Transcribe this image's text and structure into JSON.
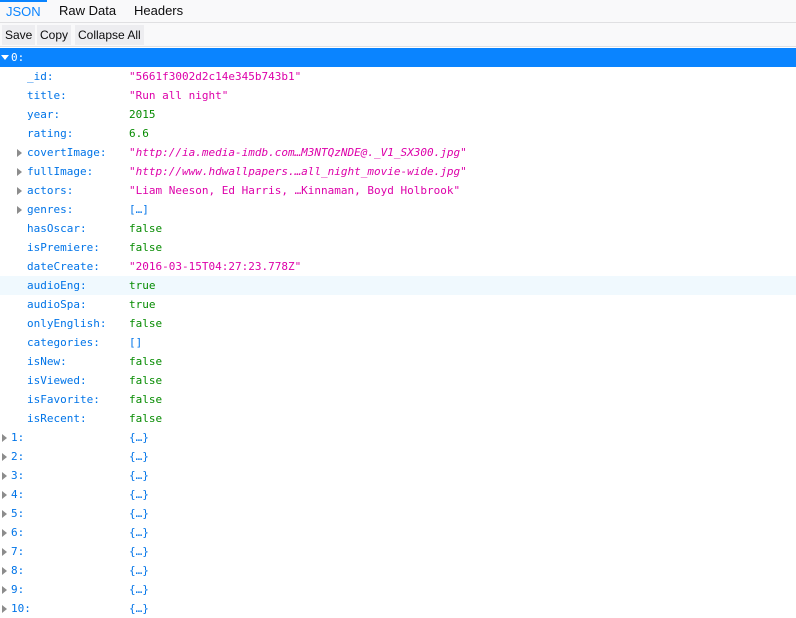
{
  "tabs": [
    {
      "label": "JSON",
      "active": true
    },
    {
      "label": "Raw Data",
      "active": false
    },
    {
      "label": "Headers",
      "active": false
    }
  ],
  "toolbar": {
    "save": "Save",
    "copy": "Copy",
    "collapse_all": "Collapse All"
  },
  "root": {
    "key": "0:",
    "expanded": true,
    "selected": true
  },
  "fields": [
    {
      "key": "_id:",
      "value": "\"5661f3002d2c14e345b743b1\"",
      "type": "string",
      "expandable": false
    },
    {
      "key": "title:",
      "value": "\"Run all night\"",
      "type": "string",
      "expandable": false
    },
    {
      "key": "year:",
      "value": "2015",
      "type": "number",
      "expandable": false
    },
    {
      "key": "rating:",
      "value": "6.6",
      "type": "number",
      "expandable": false
    },
    {
      "key": "covertImage:",
      "value": "\"http://ia.media-imdb.com…M3NTQzNDE@._V1_SX300.jpg\"",
      "type": "url",
      "expandable": true
    },
    {
      "key": "fullImage:",
      "value": "\"http://www.hdwallpapers.…all_night_movie-wide.jpg\"",
      "type": "url",
      "expandable": true
    },
    {
      "key": "actors:",
      "value": "\"Liam Neeson, Ed Harris, …Kinnaman, Boyd Holbrook\"",
      "type": "string",
      "expandable": true
    },
    {
      "key": "genres:",
      "value": "[…]",
      "type": "object",
      "expandable": true
    },
    {
      "key": "hasOscar:",
      "value": "false",
      "type": "boolean",
      "expandable": false
    },
    {
      "key": "isPremiere:",
      "value": "false",
      "type": "boolean",
      "expandable": false
    },
    {
      "key": "dateCreate:",
      "value": "\"2016-03-15T04:27:23.778Z\"",
      "type": "string",
      "expandable": false
    },
    {
      "key": "audioEng:",
      "value": "true",
      "type": "boolean",
      "expandable": false,
      "hover": true
    },
    {
      "key": "audioSpa:",
      "value": "true",
      "type": "boolean",
      "expandable": false
    },
    {
      "key": "onlyEnglish:",
      "value": "false",
      "type": "boolean",
      "expandable": false
    },
    {
      "key": "categories:",
      "value": "[]",
      "type": "object",
      "expandable": false
    },
    {
      "key": "isNew:",
      "value": "false",
      "type": "boolean",
      "expandable": false
    },
    {
      "key": "isViewed:",
      "value": "false",
      "type": "boolean",
      "expandable": false
    },
    {
      "key": "isFavorite:",
      "value": "false",
      "type": "boolean",
      "expandable": false
    },
    {
      "key": "isRecent:",
      "value": "false",
      "type": "boolean",
      "expandable": false
    }
  ],
  "collapsed_items": [
    {
      "key": "1:",
      "value": "{…}"
    },
    {
      "key": "2:",
      "value": "{…}"
    },
    {
      "key": "3:",
      "value": "{…}"
    },
    {
      "key": "4:",
      "value": "{…}"
    },
    {
      "key": "5:",
      "value": "{…}"
    },
    {
      "key": "6:",
      "value": "{…}"
    },
    {
      "key": "7:",
      "value": "{…}"
    },
    {
      "key": "8:",
      "value": "{…}"
    },
    {
      "key": "9:",
      "value": "{…}"
    },
    {
      "key": "10:",
      "value": "{…}"
    }
  ],
  "icons": {
    "expanded": "twisty-down-icon",
    "collapsed": "twisty-right-icon"
  },
  "colors": {
    "accent": "#0a84ff",
    "key": "#0074e8",
    "string": "#dd00a9",
    "number": "#058b00",
    "boolean": "#058b00",
    "hover_row": "#f0f9fe"
  }
}
